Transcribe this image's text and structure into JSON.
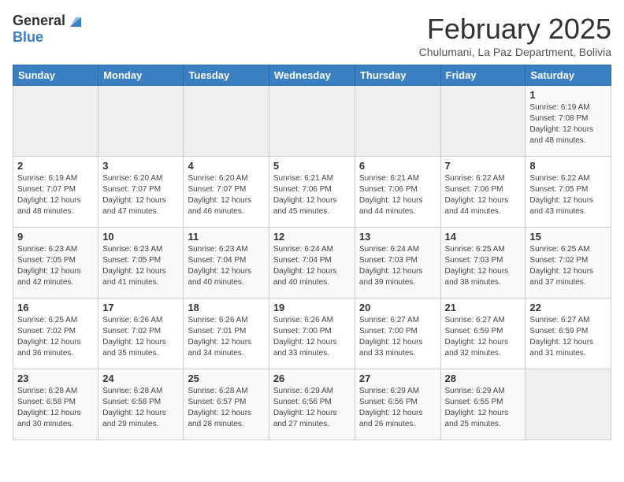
{
  "header": {
    "logo_general": "General",
    "logo_blue": "Blue",
    "month_year": "February 2025",
    "location": "Chulumani, La Paz Department, Bolivia"
  },
  "weekdays": [
    "Sunday",
    "Monday",
    "Tuesday",
    "Wednesday",
    "Thursday",
    "Friday",
    "Saturday"
  ],
  "weeks": [
    [
      {
        "day": "",
        "info": ""
      },
      {
        "day": "",
        "info": ""
      },
      {
        "day": "",
        "info": ""
      },
      {
        "day": "",
        "info": ""
      },
      {
        "day": "",
        "info": ""
      },
      {
        "day": "",
        "info": ""
      },
      {
        "day": "1",
        "info": "Sunrise: 6:19 AM\nSunset: 7:08 PM\nDaylight: 12 hours\nand 48 minutes."
      }
    ],
    [
      {
        "day": "2",
        "info": "Sunrise: 6:19 AM\nSunset: 7:07 PM\nDaylight: 12 hours\nand 48 minutes."
      },
      {
        "day": "3",
        "info": "Sunrise: 6:20 AM\nSunset: 7:07 PM\nDaylight: 12 hours\nand 47 minutes."
      },
      {
        "day": "4",
        "info": "Sunrise: 6:20 AM\nSunset: 7:07 PM\nDaylight: 12 hours\nand 46 minutes."
      },
      {
        "day": "5",
        "info": "Sunrise: 6:21 AM\nSunset: 7:06 PM\nDaylight: 12 hours\nand 45 minutes."
      },
      {
        "day": "6",
        "info": "Sunrise: 6:21 AM\nSunset: 7:06 PM\nDaylight: 12 hours\nand 44 minutes."
      },
      {
        "day": "7",
        "info": "Sunrise: 6:22 AM\nSunset: 7:06 PM\nDaylight: 12 hours\nand 44 minutes."
      },
      {
        "day": "8",
        "info": "Sunrise: 6:22 AM\nSunset: 7:05 PM\nDaylight: 12 hours\nand 43 minutes."
      }
    ],
    [
      {
        "day": "9",
        "info": "Sunrise: 6:23 AM\nSunset: 7:05 PM\nDaylight: 12 hours\nand 42 minutes."
      },
      {
        "day": "10",
        "info": "Sunrise: 6:23 AM\nSunset: 7:05 PM\nDaylight: 12 hours\nand 41 minutes."
      },
      {
        "day": "11",
        "info": "Sunrise: 6:23 AM\nSunset: 7:04 PM\nDaylight: 12 hours\nand 40 minutes."
      },
      {
        "day": "12",
        "info": "Sunrise: 6:24 AM\nSunset: 7:04 PM\nDaylight: 12 hours\nand 40 minutes."
      },
      {
        "day": "13",
        "info": "Sunrise: 6:24 AM\nSunset: 7:03 PM\nDaylight: 12 hours\nand 39 minutes."
      },
      {
        "day": "14",
        "info": "Sunrise: 6:25 AM\nSunset: 7:03 PM\nDaylight: 12 hours\nand 38 minutes."
      },
      {
        "day": "15",
        "info": "Sunrise: 6:25 AM\nSunset: 7:02 PM\nDaylight: 12 hours\nand 37 minutes."
      }
    ],
    [
      {
        "day": "16",
        "info": "Sunrise: 6:25 AM\nSunset: 7:02 PM\nDaylight: 12 hours\nand 36 minutes."
      },
      {
        "day": "17",
        "info": "Sunrise: 6:26 AM\nSunset: 7:02 PM\nDaylight: 12 hours\nand 35 minutes."
      },
      {
        "day": "18",
        "info": "Sunrise: 6:26 AM\nSunset: 7:01 PM\nDaylight: 12 hours\nand 34 minutes."
      },
      {
        "day": "19",
        "info": "Sunrise: 6:26 AM\nSunset: 7:00 PM\nDaylight: 12 hours\nand 33 minutes."
      },
      {
        "day": "20",
        "info": "Sunrise: 6:27 AM\nSunset: 7:00 PM\nDaylight: 12 hours\nand 33 minutes."
      },
      {
        "day": "21",
        "info": "Sunrise: 6:27 AM\nSunset: 6:59 PM\nDaylight: 12 hours\nand 32 minutes."
      },
      {
        "day": "22",
        "info": "Sunrise: 6:27 AM\nSunset: 6:59 PM\nDaylight: 12 hours\nand 31 minutes."
      }
    ],
    [
      {
        "day": "23",
        "info": "Sunrise: 6:28 AM\nSunset: 6:58 PM\nDaylight: 12 hours\nand 30 minutes."
      },
      {
        "day": "24",
        "info": "Sunrise: 6:28 AM\nSunset: 6:58 PM\nDaylight: 12 hours\nand 29 minutes."
      },
      {
        "day": "25",
        "info": "Sunrise: 6:28 AM\nSunset: 6:57 PM\nDaylight: 12 hours\nand 28 minutes."
      },
      {
        "day": "26",
        "info": "Sunrise: 6:29 AM\nSunset: 6:56 PM\nDaylight: 12 hours\nand 27 minutes."
      },
      {
        "day": "27",
        "info": "Sunrise: 6:29 AM\nSunset: 6:56 PM\nDaylight: 12 hours\nand 26 minutes."
      },
      {
        "day": "28",
        "info": "Sunrise: 6:29 AM\nSunset: 6:55 PM\nDaylight: 12 hours\nand 25 minutes."
      },
      {
        "day": "",
        "info": ""
      }
    ]
  ]
}
